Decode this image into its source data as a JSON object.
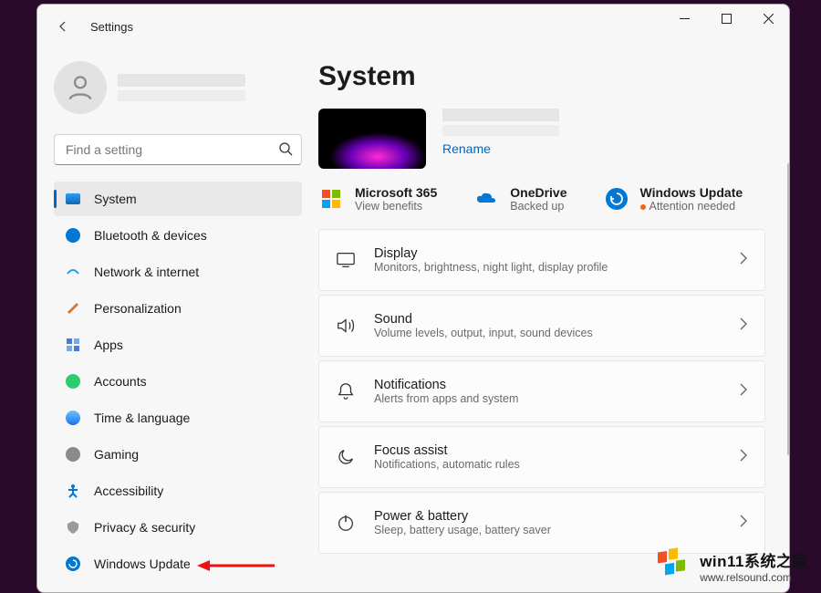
{
  "window": {
    "title": "Settings"
  },
  "search": {
    "placeholder": "Find a setting"
  },
  "nav": [
    {
      "id": "system",
      "label": "System",
      "selected": true
    },
    {
      "id": "bluetooth",
      "label": "Bluetooth & devices"
    },
    {
      "id": "network",
      "label": "Network & internet"
    },
    {
      "id": "personalization",
      "label": "Personalization"
    },
    {
      "id": "apps",
      "label": "Apps"
    },
    {
      "id": "accounts",
      "label": "Accounts"
    },
    {
      "id": "time",
      "label": "Time & language"
    },
    {
      "id": "gaming",
      "label": "Gaming"
    },
    {
      "id": "accessibility",
      "label": "Accessibility"
    },
    {
      "id": "privacy",
      "label": "Privacy & security"
    },
    {
      "id": "update",
      "label": "Windows Update"
    }
  ],
  "page": {
    "title": "System",
    "rename": "Rename"
  },
  "status_cards": [
    {
      "id": "m365",
      "title": "Microsoft 365",
      "sub": "View benefits"
    },
    {
      "id": "onedrive",
      "title": "OneDrive",
      "sub": "Backed up"
    },
    {
      "id": "update",
      "title": "Windows Update",
      "sub": "Attention needed",
      "dot": true
    }
  ],
  "settings": [
    {
      "id": "display",
      "title": "Display",
      "desc": "Monitors, brightness, night light, display profile"
    },
    {
      "id": "sound",
      "title": "Sound",
      "desc": "Volume levels, output, input, sound devices"
    },
    {
      "id": "notifications",
      "title": "Notifications",
      "desc": "Alerts from apps and system"
    },
    {
      "id": "focus",
      "title": "Focus assist",
      "desc": "Notifications, automatic rules"
    },
    {
      "id": "power",
      "title": "Power & battery",
      "desc": "Sleep, battery usage, battery saver"
    }
  ],
  "watermark": {
    "line1": "win11系统之家",
    "line2": "www.relsound.com"
  }
}
